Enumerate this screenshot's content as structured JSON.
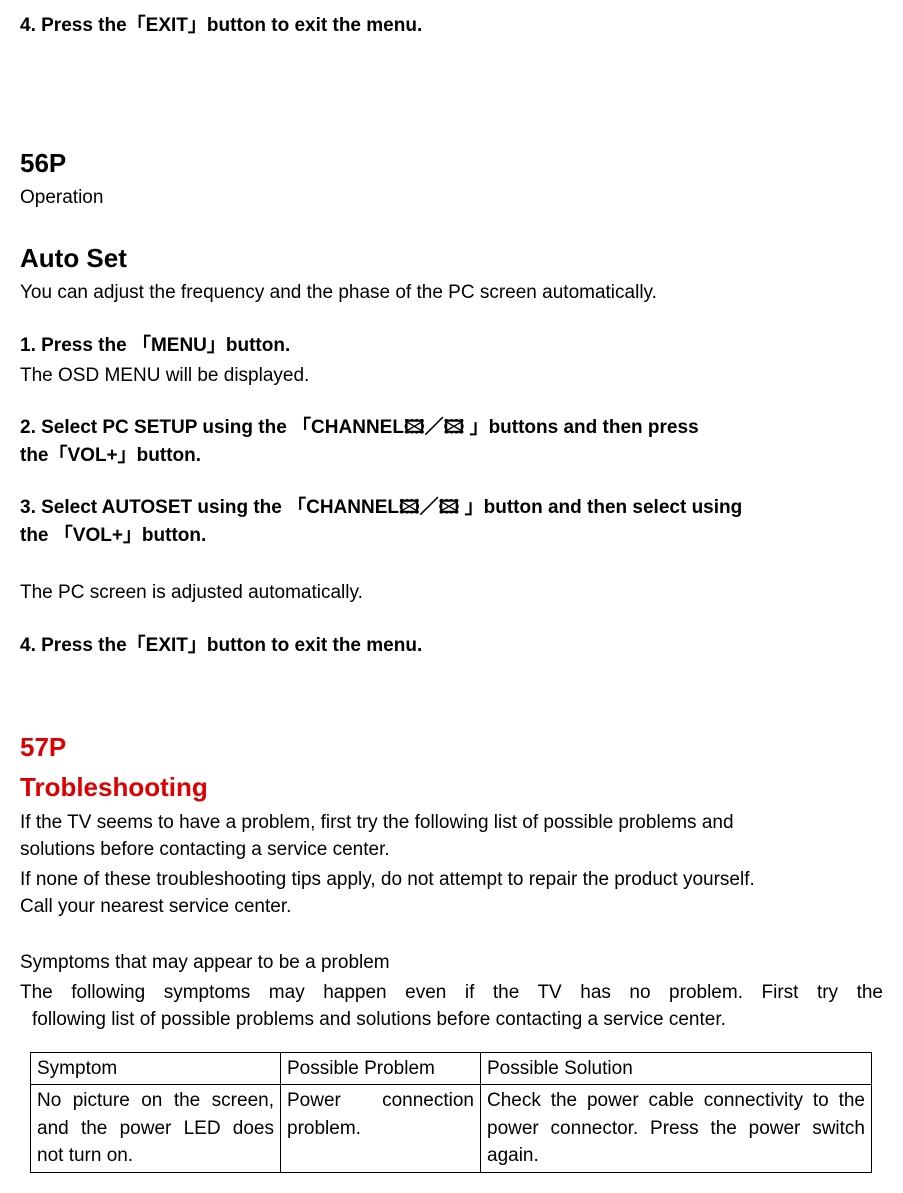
{
  "step_exit_prev": "4. Press the「EXIT」button to exit the menu.",
  "page_56": {
    "num": "56P",
    "sub": "Operation",
    "heading": "Auto Set",
    "intro": "You can adjust the frequency and the phase of the PC screen automatically.",
    "step1": "1. Press the 「MENU」button.",
    "step1_desc": "The OSD MENU will be displayed.",
    "step2_l1": "2. Select PC SETUP using the 「CHANNEL🖾／🖾 」buttons and then press",
    "step2_l2": "the「VOL+」button.",
    "step3_l1": "3. Select AUTOSET using the 「CHANNEL🖾／🖾 」button and then select using",
    "step3_l2": "the 「VOL+」button.",
    "step3_desc": " The PC screen is adjusted automatically.",
    "step4": "4. Press the「EXIT」button to exit the menu."
  },
  "page_57": {
    "num": "57P",
    "heading": "Trobleshooting",
    "p1_l1": "If the TV seems to have a problem, first try the following list of possible problems and",
    "p1_l2": "solutions before contacting a service center.",
    "p2_l1": "If none of these troubleshooting tips apply, do not attempt to repair the product yourself.",
    "p2_l2": "Call your nearest service center.",
    "symptoms_head": "Symptoms that may appear to be a problem",
    "symptoms_l1": "The following  symptoms may happen even if the TV has no problem. First try the",
    "symptoms_l2": "following list of possible problems and solutions before contacting a service center.",
    "table": {
      "h1": "Symptom",
      "h2": "Possible Problem",
      "h3": "Possible Solution",
      "r1c1": "No picture on the screen, and the power LED does not turn on.",
      "r1c2": "Power connection problem.",
      "r1c3": "Check the power cable connectivity to the power connector. Press the power switch again."
    }
  }
}
